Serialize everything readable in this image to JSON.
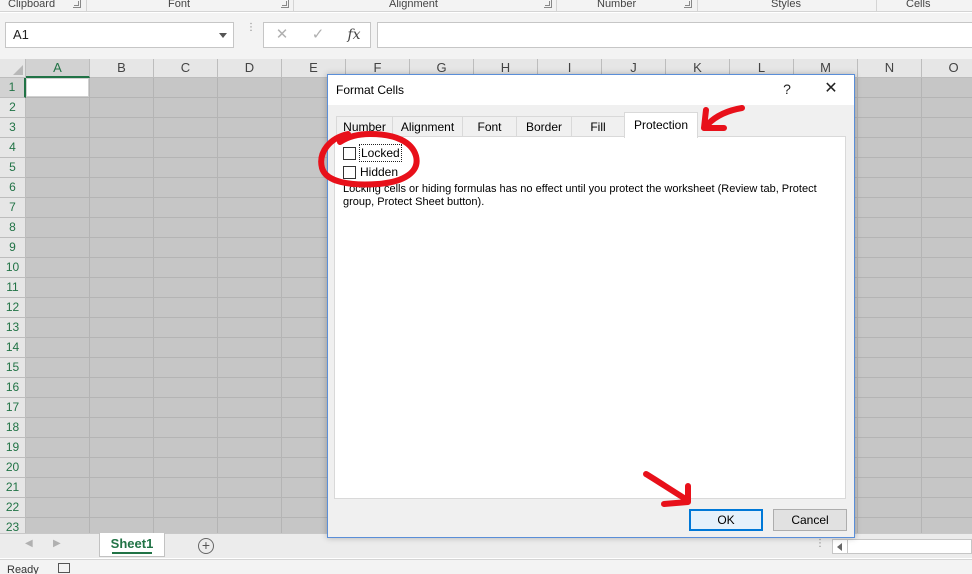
{
  "ribbon": {
    "groups": [
      "Clipboard",
      "Font",
      "Alignment",
      "Number",
      "Styles",
      "Cells"
    ]
  },
  "formula_bar": {
    "name_box": "A1",
    "fx_label": "fx",
    "cancel_glyph": "✕",
    "enter_glyph": "✓",
    "formula": ""
  },
  "sheet": {
    "columns": [
      "A",
      "B",
      "C",
      "D",
      "E",
      "F",
      "G",
      "H",
      "I",
      "J",
      "K",
      "L",
      "M",
      "N",
      "O"
    ],
    "rows": [
      "1",
      "2",
      "3",
      "4",
      "5",
      "6",
      "7",
      "8",
      "9",
      "10",
      "11",
      "12",
      "13",
      "14",
      "15",
      "16",
      "17",
      "18",
      "19",
      "20",
      "21",
      "22",
      "23"
    ],
    "active_cell": "A1"
  },
  "tabs_bar": {
    "sheet_name": "Sheet1",
    "add_glyph": "+"
  },
  "status": {
    "text": "Ready"
  },
  "dialog": {
    "title": "Format Cells",
    "help_glyph": "?",
    "close_glyph": "✕",
    "tabs": [
      "Number",
      "Alignment",
      "Font",
      "Border",
      "Fill",
      "Protection"
    ],
    "active_tab": "Protection",
    "locked_label": "Locked",
    "locked_checked": false,
    "hidden_label": "Hidden",
    "hidden_checked": false,
    "note": "Locking cells or hiding formulas has no effect until you protect the worksheet (Review tab, Protect group, Protect Sheet button).",
    "ok_label": "OK",
    "cancel_label": "Cancel"
  },
  "colors": {
    "accent": "#217346",
    "annotation": "#e8101a",
    "dialog_border": "#5a8ed8"
  },
  "icons": [
    "chevron-down-icon",
    "cancel-icon",
    "enter-icon",
    "fx-icon",
    "help-icon",
    "close-icon",
    "add-sheet-icon",
    "macro-record-icon"
  ]
}
